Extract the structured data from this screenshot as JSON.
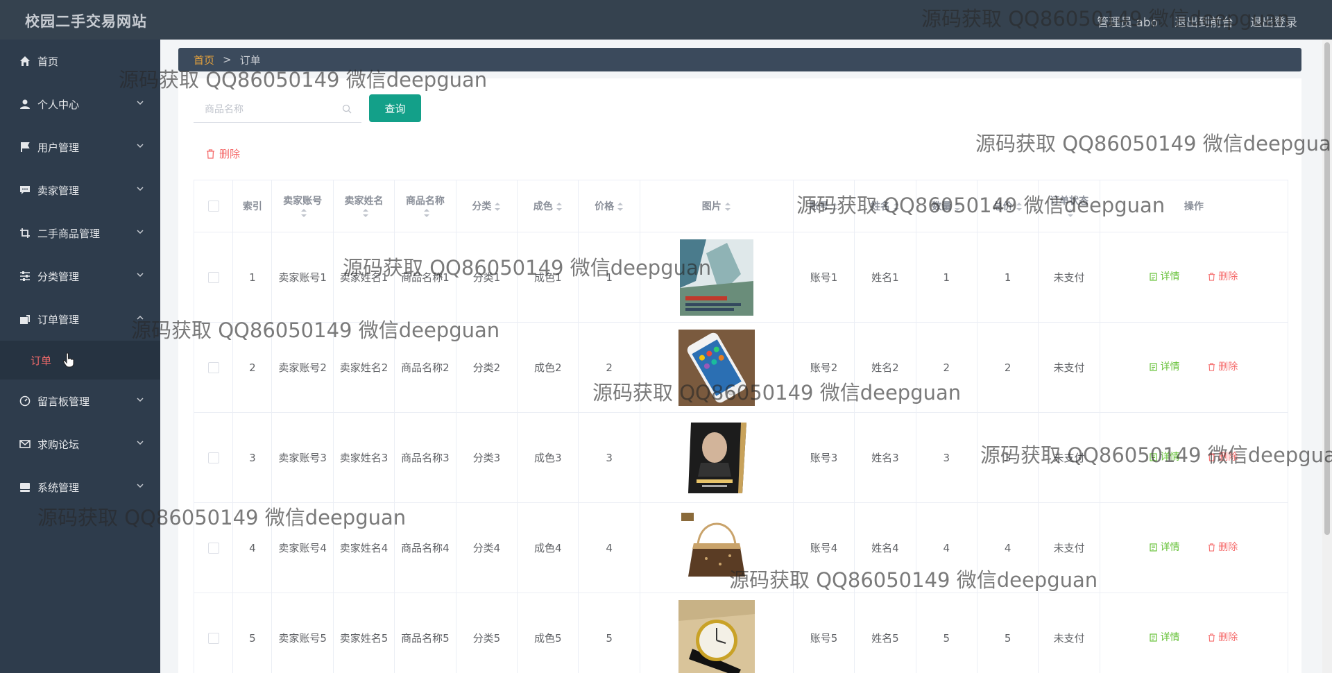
{
  "app": {
    "title": "校园二手交易网站"
  },
  "header": {
    "user": "管理员 abo",
    "back_label": "退出到前台",
    "logout_label": "退出登录"
  },
  "sidebar": {
    "items": [
      {
        "label": "首页",
        "icon": "home-icon"
      },
      {
        "label": "个人中心",
        "icon": "user-icon"
      },
      {
        "label": "用户管理",
        "icon": "flag-icon"
      },
      {
        "label": "卖家管理",
        "icon": "chat-icon"
      },
      {
        "label": "二手商品管理",
        "icon": "crop-icon"
      },
      {
        "label": "分类管理",
        "icon": "sliders-icon"
      },
      {
        "label": "订单管理",
        "icon": "order-icon"
      },
      {
        "label": "留言板管理",
        "icon": "dashboard-icon"
      },
      {
        "label": "求购论坛",
        "icon": "mail-icon"
      },
      {
        "label": "系统管理",
        "icon": "storage-icon"
      }
    ],
    "active_sub": "订单"
  },
  "breadcrumb": {
    "home": "首页",
    "separator": ">",
    "current": "订单"
  },
  "search": {
    "placeholder": "商品名称",
    "button": "查询"
  },
  "toolbar": {
    "delete_label": "删除"
  },
  "table": {
    "columns": [
      "索引",
      "卖家账号",
      "卖家姓名",
      "商品名称",
      "分类",
      "成色",
      "价格",
      "图片",
      "账号",
      "姓名",
      "数量",
      "总价",
      "订单状态",
      "操作"
    ],
    "rows": [
      {
        "idx": "1",
        "seller_acc": "卖家账号1",
        "seller_name": "卖家姓名1",
        "product": "商品名称1",
        "category": "分类1",
        "condition": "成色1",
        "price": "1",
        "image": "book-cover",
        "account": "账号1",
        "name": "姓名1",
        "qty": "1",
        "total": "1",
        "status": "未支付"
      },
      {
        "idx": "2",
        "seller_acc": "卖家账号2",
        "seller_name": "卖家姓名2",
        "product": "商品名称2",
        "category": "分类2",
        "condition": "成色2",
        "price": "2",
        "image": "smartphone",
        "account": "账号2",
        "name": "姓名2",
        "qty": "2",
        "total": "2",
        "status": "未支付"
      },
      {
        "idx": "3",
        "seller_acc": "卖家账号3",
        "seller_name": "卖家姓名3",
        "product": "商品名称3",
        "category": "分类3",
        "condition": "成色3",
        "price": "3",
        "image": "biography-book",
        "account": "账号3",
        "name": "姓名3",
        "qty": "3",
        "total": "3",
        "status": "未支付"
      },
      {
        "idx": "4",
        "seller_acc": "卖家账号4",
        "seller_name": "卖家姓名4",
        "product": "商品名称4",
        "category": "分类4",
        "condition": "成色4",
        "price": "4",
        "image": "handbag",
        "account": "账号4",
        "name": "姓名4",
        "qty": "4",
        "total": "4",
        "status": "未支付"
      },
      {
        "idx": "5",
        "seller_acc": "卖家账号5",
        "seller_name": "卖家姓名5",
        "product": "商品名称5",
        "category": "分类5",
        "condition": "成色5",
        "price": "5",
        "image": "wristwatch",
        "account": "账号5",
        "name": "姓名5",
        "qty": "5",
        "total": "5",
        "status": "未支付"
      }
    ],
    "ops": {
      "detail": "详情",
      "delete": "删除"
    }
  },
  "watermark": "源码获取 QQ86050149 微信deepguan",
  "colors": {
    "sidebar": "#2e3c4c",
    "accent": "#13a089",
    "danger": "#f56c6c",
    "success": "#67c23a",
    "warning": "#e6a23c"
  }
}
